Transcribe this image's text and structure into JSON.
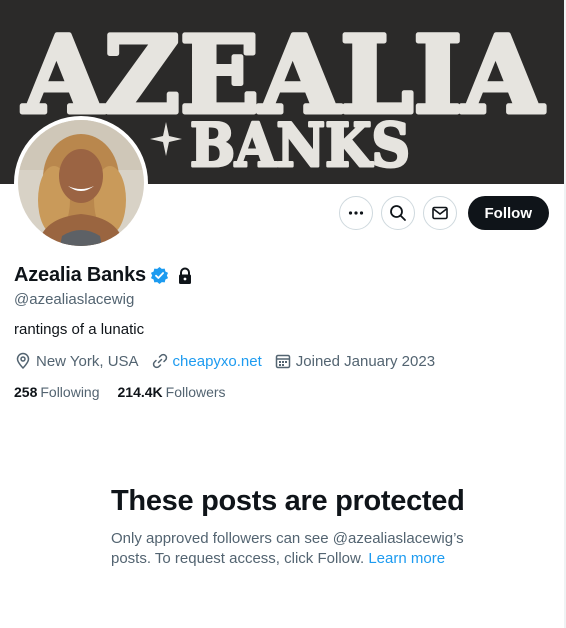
{
  "banner": {
    "line1": "AZEALIA",
    "line2": "BANKS",
    "bg_color": "#2b2a29",
    "text_color": "#e6e4df"
  },
  "profile": {
    "display_name": "Azealia Banks",
    "handle": "@azealiaslacewig",
    "bio": "rantings of a lunatic",
    "location": "New York, USA",
    "website": "cheapyxo.net",
    "joined": "Joined January 2023",
    "following_count": "258",
    "following_label": "Following",
    "followers_count": "214.4K",
    "followers_label": "Followers",
    "verified": true,
    "protected": true
  },
  "actions": {
    "more_icon": "more-horizontal-icon",
    "search_icon": "search-icon",
    "message_icon": "envelope-icon",
    "follow_label": "Follow"
  },
  "protected_notice": {
    "title": "These posts are protected",
    "body": "Only approved followers can see @azealiaslacewig’s posts. To request access, click Follow.",
    "learn_more": "Learn more"
  },
  "colors": {
    "accent": "#1d9bf0",
    "text_primary": "#0f1419",
    "text_secondary": "#536471",
    "button_dark": "#0f1419"
  }
}
